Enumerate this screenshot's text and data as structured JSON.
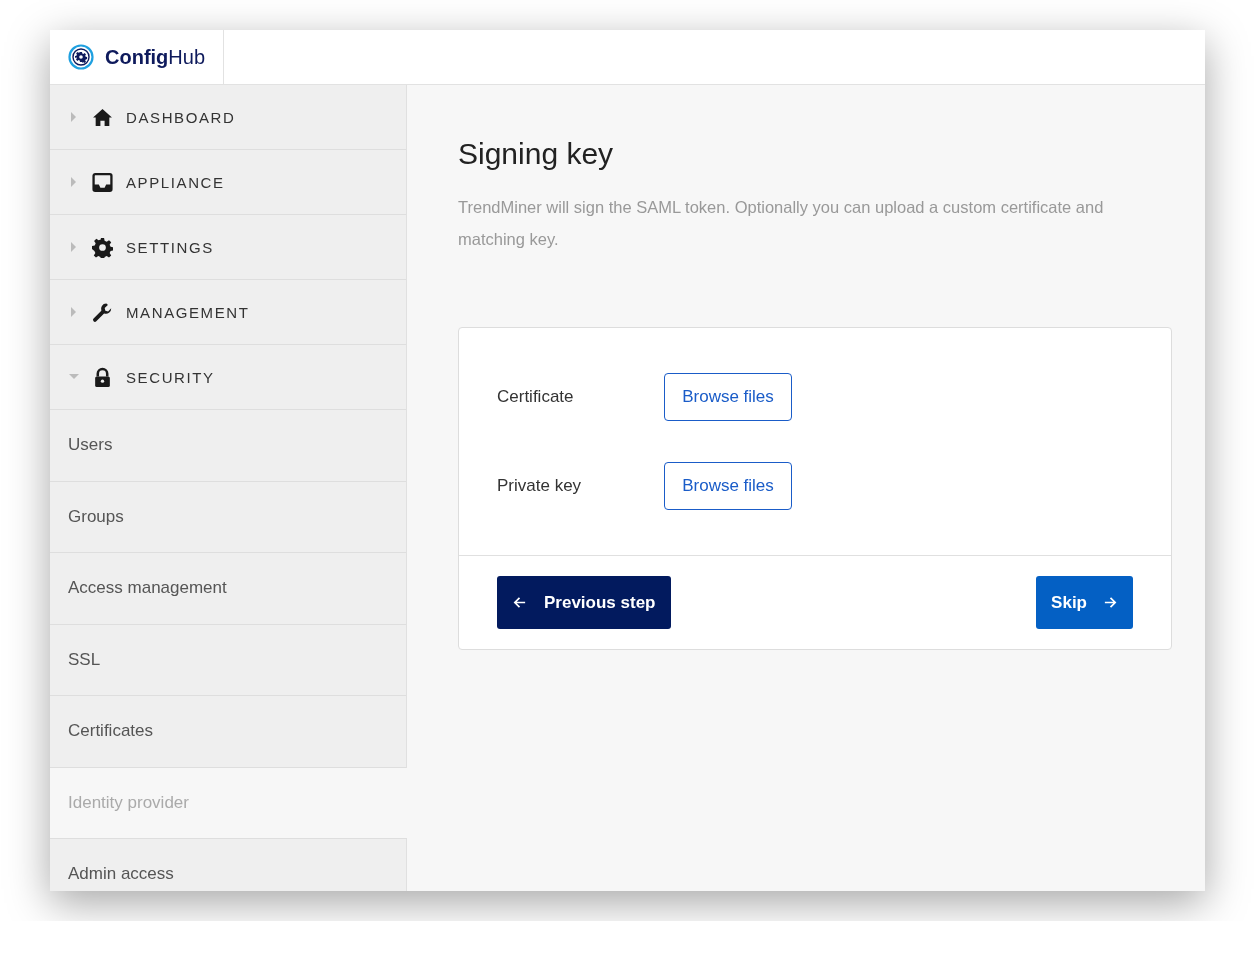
{
  "app": {
    "name_bold": "Config",
    "name_light": "Hub"
  },
  "sidebar": {
    "sections": [
      {
        "label": "DASHBOARD",
        "kind": "home",
        "expanded": false
      },
      {
        "label": "APPLIANCE",
        "kind": "inbox",
        "expanded": false
      },
      {
        "label": "SETTINGS",
        "kind": "gear",
        "expanded": false
      },
      {
        "label": "MANAGEMENT",
        "kind": "wrench",
        "expanded": false
      },
      {
        "label": "SECURITY",
        "kind": "lock",
        "expanded": true,
        "children": [
          {
            "label": "Users",
            "selected": false
          },
          {
            "label": "Groups",
            "selected": false
          },
          {
            "label": "Access management",
            "selected": false
          },
          {
            "label": "SSL",
            "selected": false
          },
          {
            "label": "Certificates",
            "selected": false
          },
          {
            "label": "Identity provider",
            "selected": true
          },
          {
            "label": "Admin access",
            "selected": false
          }
        ]
      }
    ]
  },
  "page": {
    "title": "Signing key",
    "description": "TrendMiner will sign the SAML token. Optionally you can upload a custom certificate and matching key.",
    "fields": [
      {
        "label": "Certificate",
        "button": "Browse files"
      },
      {
        "label": "Private key",
        "button": "Browse files"
      }
    ],
    "back_button": "Previous step",
    "next_button": "Skip"
  }
}
